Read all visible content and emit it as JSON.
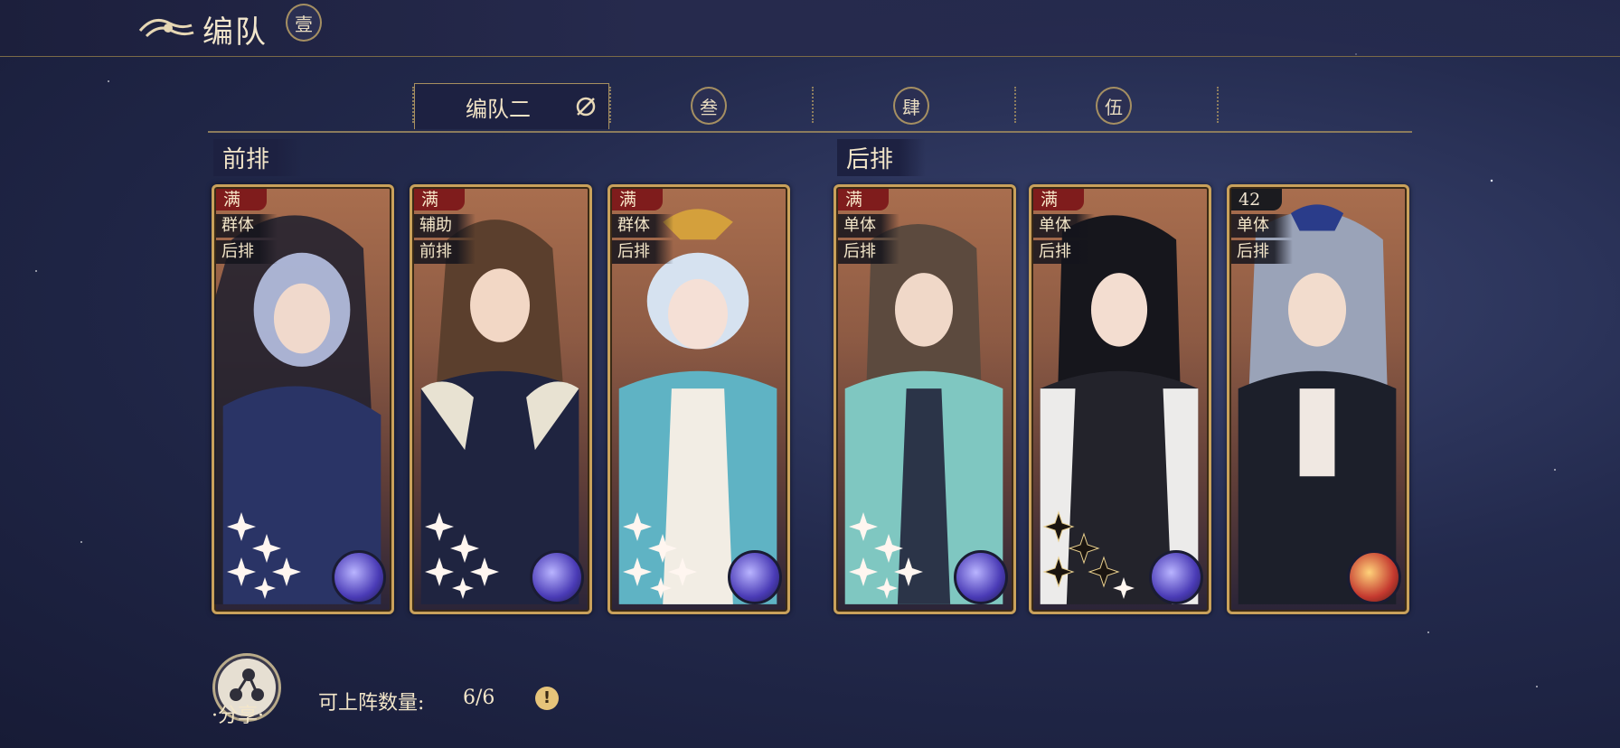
{
  "header": {
    "title": "编队"
  },
  "tabs": [
    {
      "label": "壹",
      "active": false
    },
    {
      "label": "编队二",
      "active": true
    },
    {
      "label": "叁",
      "active": false
    },
    {
      "label": "肆",
      "active": false
    },
    {
      "label": "伍",
      "active": false
    }
  ],
  "rows": {
    "front": "前排",
    "back": "后排"
  },
  "cards": [
    {
      "level": "满",
      "tag1": "群体",
      "tag2": "后排",
      "orb": "blue-purple",
      "stars": 5
    },
    {
      "level": "满",
      "tag1": "辅助",
      "tag2": "前排",
      "orb": "blue-purple",
      "stars": 5
    },
    {
      "level": "满",
      "tag1": "群体",
      "tag2": "后排",
      "orb": "blue-purple",
      "stars": 5
    },
    {
      "level": "满",
      "tag1": "单体",
      "tag2": "后排",
      "orb": "blue-purple",
      "stars": 5
    },
    {
      "level": "满",
      "tag1": "单体",
      "tag2": "后排",
      "orb": "blue-purple",
      "stars": 5
    },
    {
      "level": "42",
      "tag1": "单体",
      "tag2": "后排",
      "orb": "red-gold",
      "stars": 0
    }
  ],
  "footer": {
    "share_label": "·分享·",
    "count_label": "可上阵数量:",
    "count_value": "6/6",
    "info_icon": "!"
  },
  "colors": {
    "accent_gold": "#c9a15b",
    "level_red": "#7f1c1c",
    "background": "#232a4d"
  },
  "icons": {
    "header": "cloud-emblem-icon",
    "hide": "eye-slash-icon",
    "share": "share-nodes-icon",
    "info": "info-icon"
  }
}
